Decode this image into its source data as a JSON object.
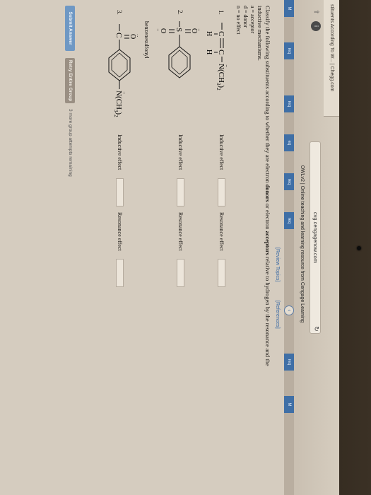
{
  "browser": {
    "tab_title": "stituents According To W... | Chegg.com",
    "url": "cvg.cengagenow.com",
    "page_header": "OWLv2 | Online teaching and learning resource from Cengage Learning"
  },
  "sidebar": {
    "items": [
      "M",
      "req",
      "req",
      "eq",
      "req",
      "req",
      "req",
      "M"
    ]
  },
  "question": {
    "links": [
      "[Review Topics]",
      "[References]"
    ],
    "instructions_line1": "Classify the following substituents according to whether they are electron",
    "instructions_bold1": "donors",
    "instructions_mid": "or electron",
    "instructions_bold2": "acceptors",
    "instructions_line1_end": "relative to hydrogen by the resonance and the",
    "instructions_line2": "inductive mechanisms.",
    "legend": [
      "a = acceptor",
      "d = donor",
      "n = no effect"
    ],
    "items": [
      {
        "number": "1.",
        "inductive_label": "Inductive effect",
        "inductive_value": "",
        "resonance_label": "Resonance effect",
        "resonance_value": ""
      },
      {
        "number": "2.",
        "name": "benzenesulfonyl",
        "inductive_label": "Inductive effect",
        "inductive_value": "",
        "resonance_label": "Resonance effect",
        "resonance_value": ""
      },
      {
        "number": "3.",
        "inductive_label": "Inductive effect",
        "inductive_value": "",
        "resonance_label": "Resonance effect",
        "resonance_value": ""
      }
    ],
    "chem": {
      "s1_group": "N(CH",
      "s1_sub": "3",
      "s1_tail": ")",
      "s1_sub2": "2",
      "h": "H",
      "c": "C",
      "s": "S",
      "o": "O",
      "s3_group": "N(CH",
      "s3_sub": "3",
      "s3_tail": ")",
      "s3_sub2": "2"
    }
  },
  "actions": {
    "submit_label": "Submit Answer",
    "retry_label": "Retry Entire Group",
    "attempts_text": "3 more group attempts remaining"
  }
}
